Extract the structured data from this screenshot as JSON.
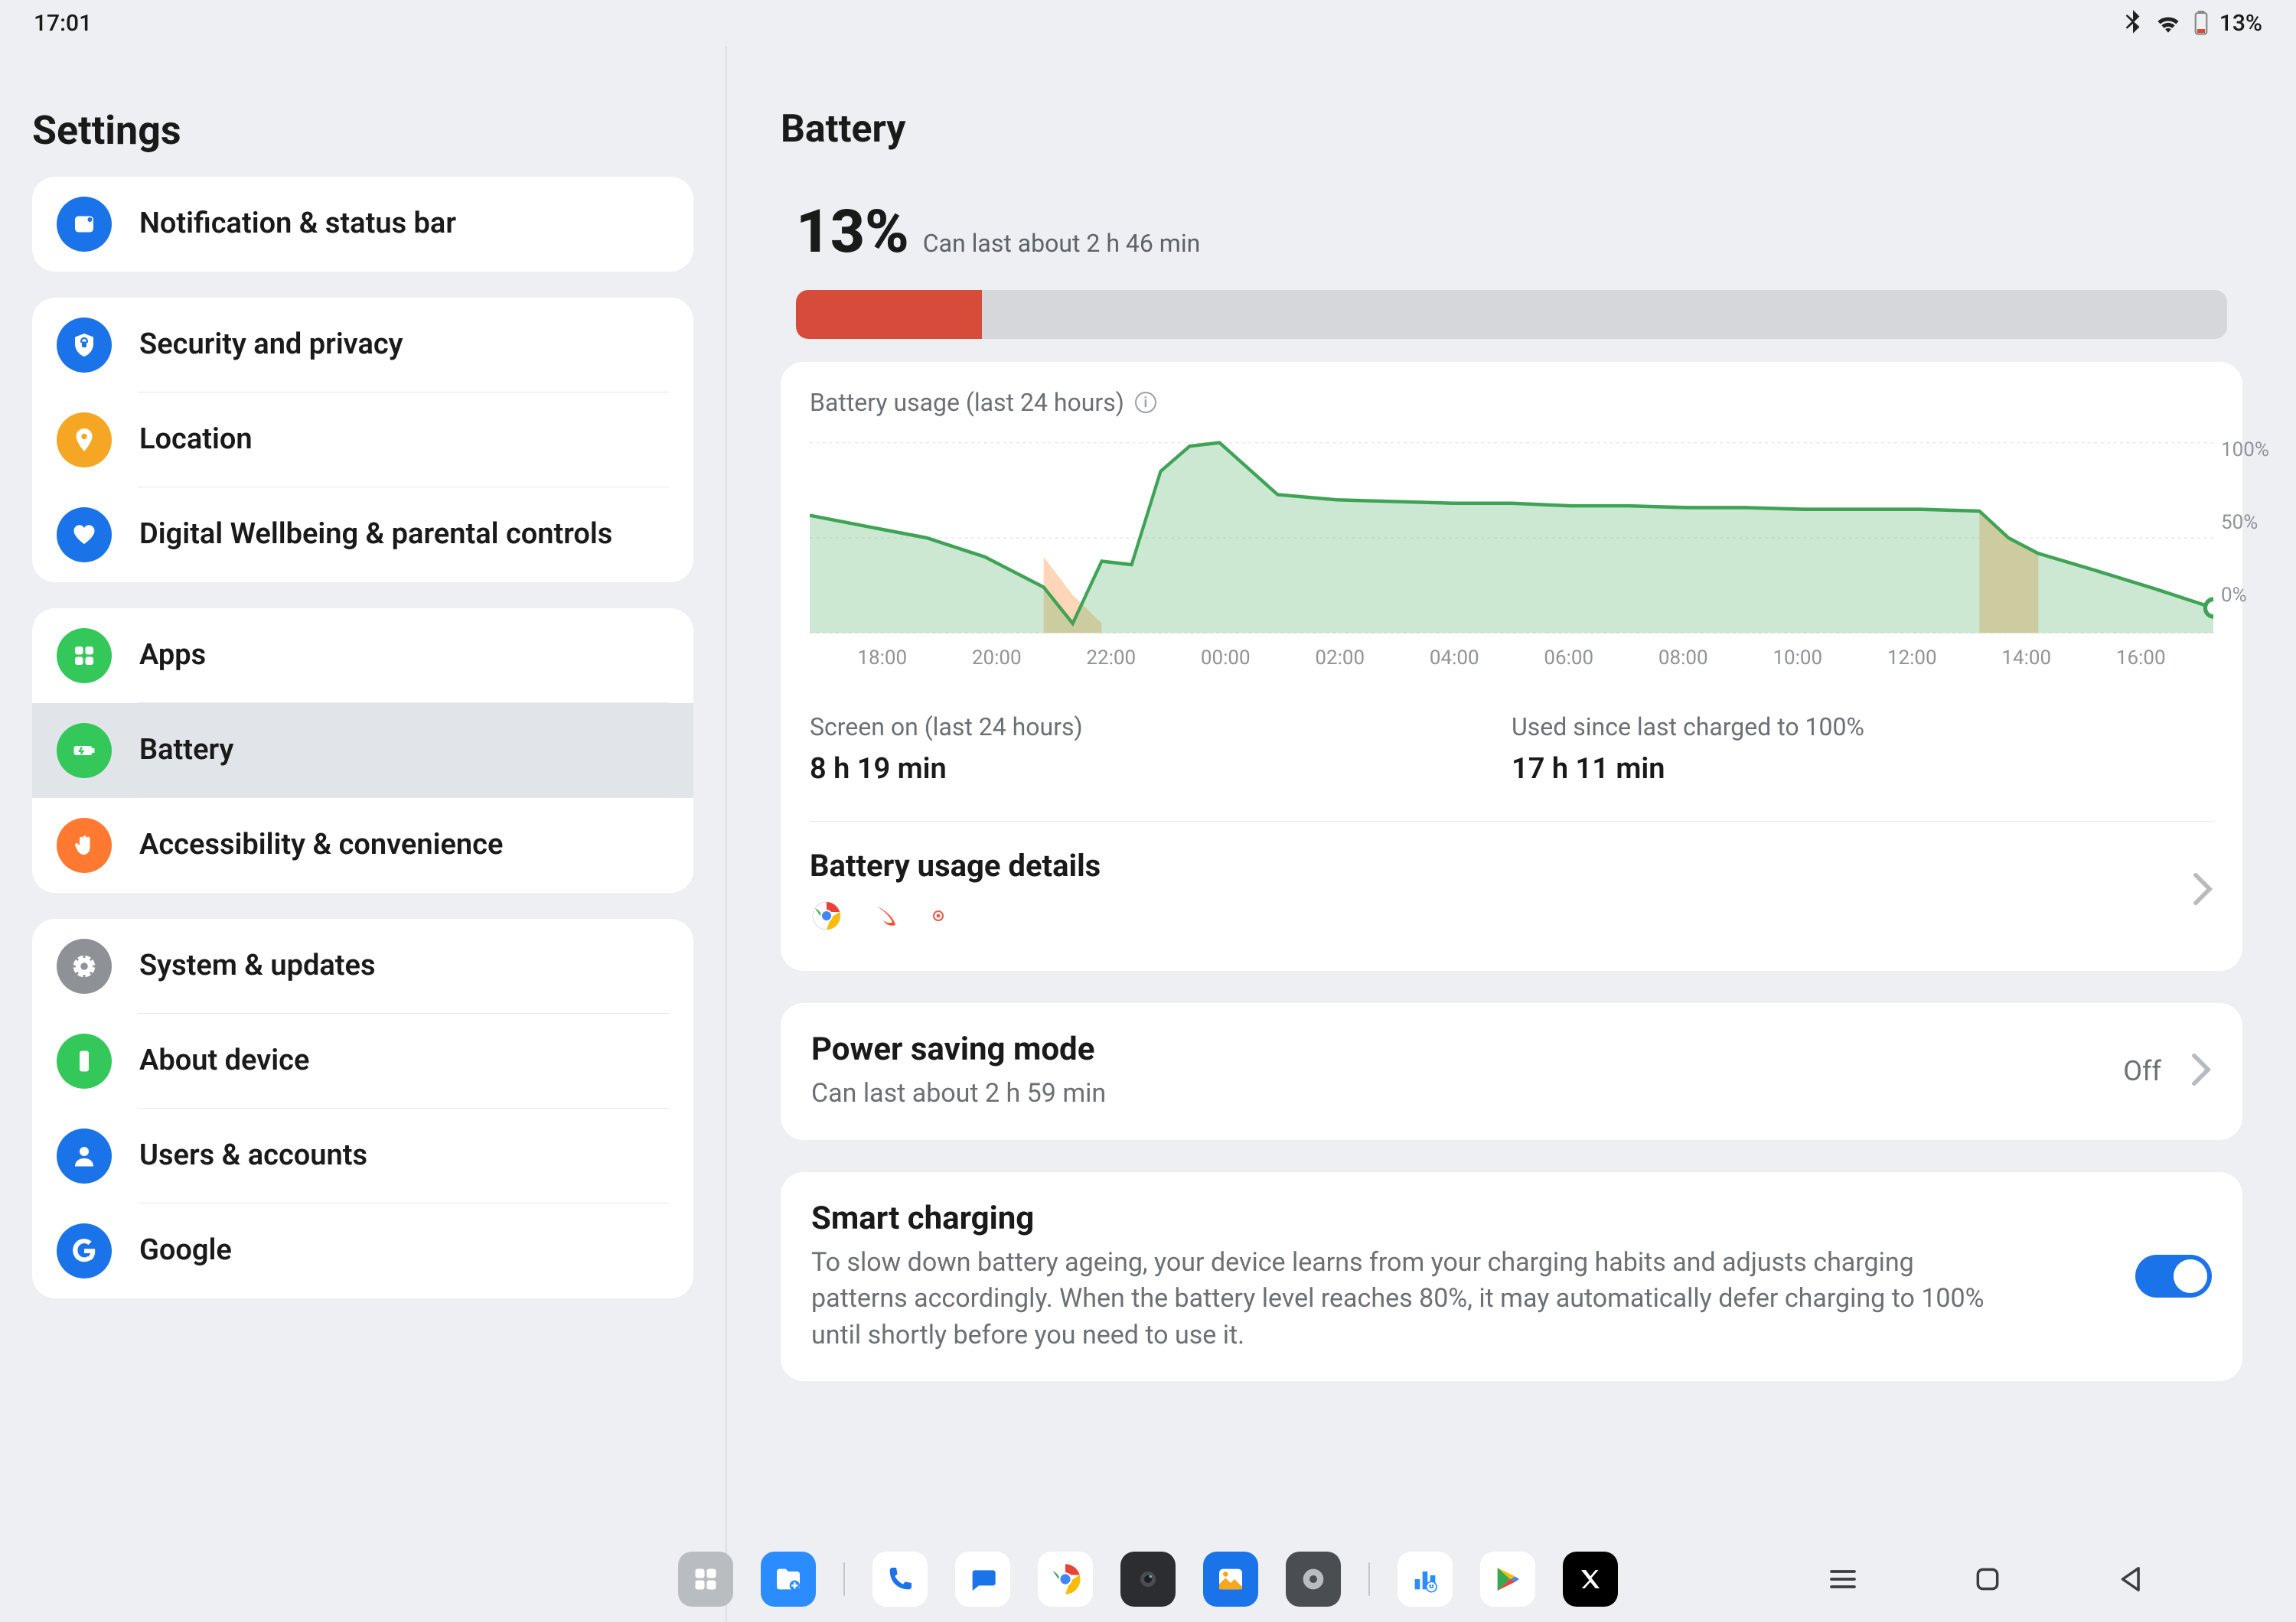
{
  "status": {
    "time": "17:01",
    "battery_pct": "13%"
  },
  "sidebar": {
    "title": "Settings",
    "groups": [
      [
        {
          "key": "notif",
          "label": "Notification & status bar",
          "color": "#1a73e8"
        }
      ],
      [
        {
          "key": "security",
          "label": "Security and privacy",
          "color": "#1a73e8"
        },
        {
          "key": "location",
          "label": "Location",
          "color": "#f5a623"
        },
        {
          "key": "wellbeing",
          "label": "Digital Wellbeing & parental controls",
          "color": "#1a73e8"
        }
      ],
      [
        {
          "key": "apps",
          "label": "Apps",
          "color": "#34c759"
        },
        {
          "key": "battery",
          "label": "Battery",
          "color": "#34c759",
          "selected": true
        },
        {
          "key": "accessibility",
          "label": "Accessibility & convenience",
          "color": "#ff7a30"
        }
      ],
      [
        {
          "key": "system",
          "label": "System & updates",
          "color": "#8e9297"
        },
        {
          "key": "about",
          "label": "About device",
          "color": "#34c759"
        },
        {
          "key": "users",
          "label": "Users & accounts",
          "color": "#1a73e8"
        },
        {
          "key": "google",
          "label": "Google",
          "color": "#1a73e8"
        }
      ]
    ]
  },
  "battery": {
    "title": "Battery",
    "pct": "13%",
    "estimate": "Can last about 2 h 46 min",
    "fill_pct": 13,
    "usage_title": "Battery usage (last 24 hours)",
    "screen_on_label": "Screen on (last 24 hours)",
    "screen_on_value": "8 h 19 min",
    "since_label": "Used since last charged to 100%",
    "since_value": "17 h 11 min",
    "details_title": "Battery usage details",
    "psm_title": "Power saving mode",
    "psm_sub": "Can last about 2 h 59 min",
    "psm_value": "Off",
    "smart_title": "Smart charging",
    "smart_sub": "To slow down battery ageing, your device learns from your charging habits and adjusts charging patterns accordingly. When the battery level reaches 80%, it may automatically defer charging to 100% until shortly before you need to use it.",
    "smart_on": true
  },
  "chart_data": {
    "type": "area",
    "title": "Battery usage (last 24 hours)",
    "ylabel": "%",
    "ylim": [
      0,
      100
    ],
    "y_ticks": [
      0,
      50,
      100
    ],
    "x_ticks": [
      "18:00",
      "20:00",
      "22:00",
      "00:00",
      "02:00",
      "04:00",
      "06:00",
      "08:00",
      "10:00",
      "12:00",
      "14:00",
      "16:00"
    ],
    "series": [
      {
        "name": "battery_level",
        "color": "#57b26a",
        "x": [
          "17:00",
          "18:00",
          "19:00",
          "20:00",
          "21:00",
          "21:30",
          "22:00",
          "22:30",
          "23:00",
          "23:30",
          "00:00",
          "01:00",
          "02:00",
          "03:00",
          "04:00",
          "05:00",
          "06:00",
          "07:00",
          "08:00",
          "09:00",
          "10:00",
          "11:00",
          "12:00",
          "13:00",
          "13:30",
          "14:00",
          "15:00",
          "16:00",
          "17:00"
        ],
        "values": [
          62,
          56,
          50,
          40,
          24,
          5,
          38,
          36,
          85,
          98,
          100,
          73,
          70,
          69,
          68,
          68,
          67,
          67,
          66,
          66,
          65,
          65,
          65,
          64,
          50,
          42,
          33,
          23,
          13
        ]
      }
    ],
    "low_battery_spans": [
      {
        "from": "21:00",
        "to": "22:00"
      },
      {
        "from": "13:00",
        "to": "14:00"
      }
    ],
    "current": {
      "x": "17:00",
      "value": 13
    }
  },
  "y_labels": {
    "top": "100%",
    "mid": "50%",
    "bot": "0%"
  },
  "x_labels": [
    "18:00",
    "20:00",
    "22:00",
    "00:00",
    "02:00",
    "04:00",
    "06:00",
    "08:00",
    "10:00",
    "12:00",
    "14:00",
    "16:00"
  ]
}
